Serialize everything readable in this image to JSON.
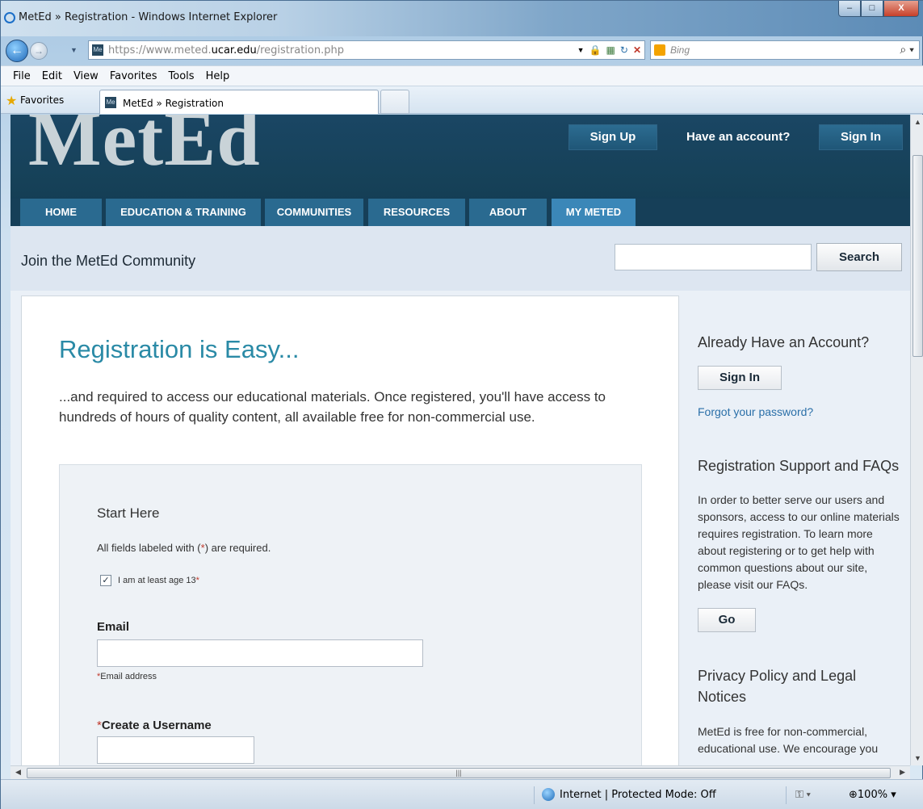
{
  "window": {
    "title": "MetEd » Registration - Windows Internet Explorer",
    "minimize": "–",
    "maximize": "□",
    "close": "X"
  },
  "addressbar": {
    "url_prefix": "https://www.meted.",
    "url_domain": "ucar.edu",
    "url_path": "/registration.php",
    "search_placeholder": "Bing"
  },
  "menu": [
    "File",
    "Edit",
    "View",
    "Favorites",
    "Tools",
    "Help"
  ],
  "favorites": {
    "label": "Favorites",
    "tab_title": "MetEd » Registration"
  },
  "site": {
    "logo": "MetEd",
    "signup": "Sign Up",
    "have_account": "Have an account?",
    "signin": "Sign In",
    "nav": [
      "HOME",
      "EDUCATION & TRAINING",
      "COMMUNITIES",
      "RESOURCES",
      "ABOUT",
      "MY METED"
    ],
    "nav_active": "MY METED"
  },
  "subheader": {
    "title": "Join the MetEd Community",
    "search_button": "Search"
  },
  "main": {
    "heading": "Registration is Easy...",
    "intro": "...and required to access our educational materials. Once registered, you'll have access to hundreds of hours of quality content, all available free for non-commercial use.",
    "form": {
      "start": "Start Here",
      "required_prefix": "All fields labeled with (",
      "required_star": "*",
      "required_suffix": ") are required.",
      "age_label": "I am at least age 13",
      "age_checked": true,
      "email_label": "Email",
      "email_hint": "Email address",
      "username_label": "Create a Username"
    }
  },
  "sidebar": {
    "account_heading": "Already Have an Account?",
    "signin_button": "Sign In",
    "forgot_link": "Forgot your password?",
    "support_heading": "Registration Support and FAQs",
    "support_text": "In order to better serve our users and sponsors, access to our online materials requires registration. To learn more about registering or to get help with common questions about our site, please visit our FAQs.",
    "go_button": "Go",
    "privacy_heading": "Privacy Policy and Legal Notices",
    "privacy_text": "MetEd is free for non-commercial, educational use. We encourage you"
  },
  "statusbar": {
    "zone": "Internet | Protected Mode: Off",
    "zoom": "100%"
  }
}
